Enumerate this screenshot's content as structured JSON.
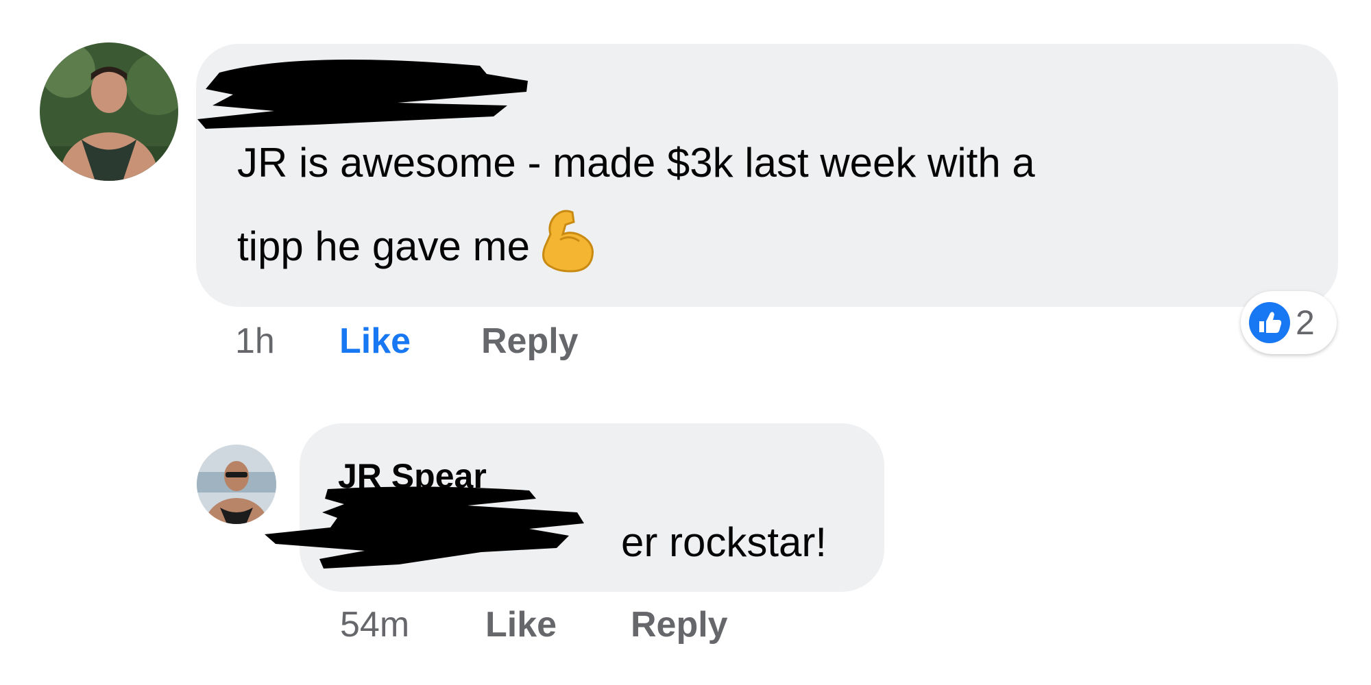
{
  "comments": [
    {
      "text_line_1": "JR is awesome - made $3k last week with a",
      "text_line_2": "tipp he gave me",
      "emoji": "flexed-biceps",
      "time": "1h",
      "like_label": "Like",
      "reply_label": "Reply",
      "reaction_count": "2",
      "reaction_icon": "like-thumb-icon",
      "liked_color": "#1877f2"
    }
  ],
  "reply": {
    "author": "JR Spear",
    "text": "er rockstar!",
    "time": "54m",
    "like_label": "Like",
    "reply_label": "Reply"
  },
  "colors": {
    "bubble": "#eff0f2",
    "meta": "#65676b",
    "accent": "#1877f2",
    "redaction": "#000000"
  }
}
